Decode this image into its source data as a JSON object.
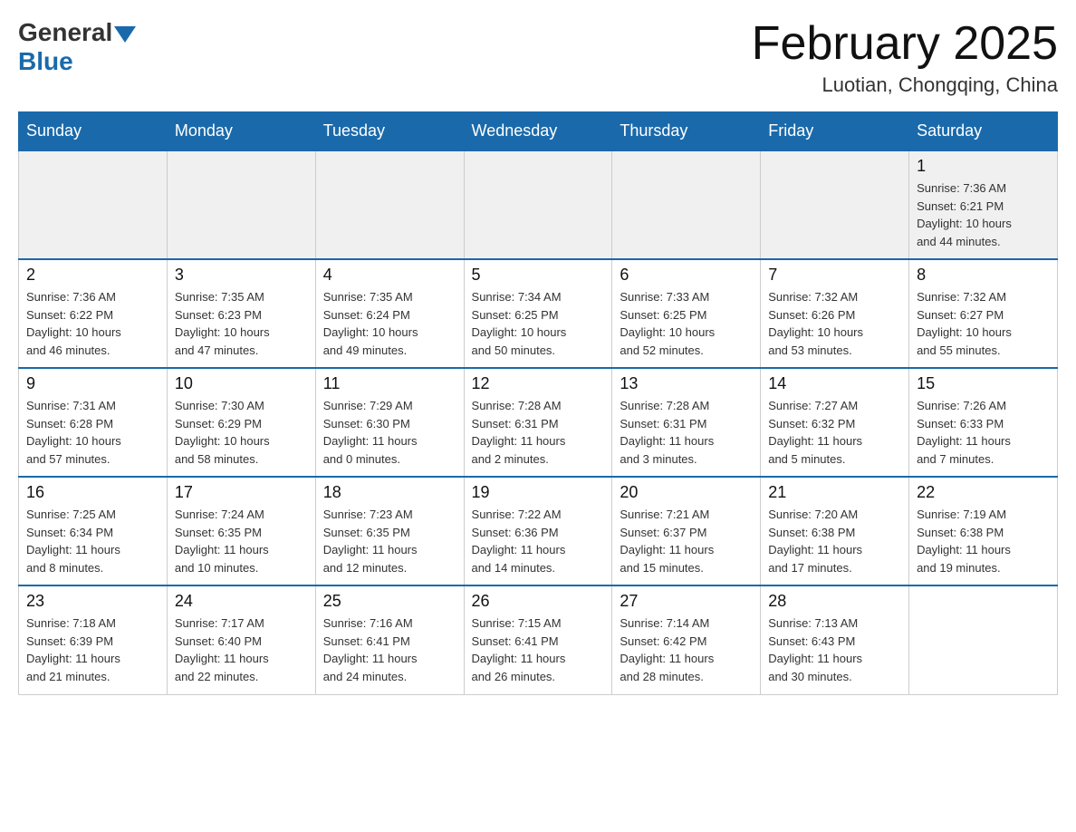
{
  "header": {
    "logo_general": "General",
    "logo_blue": "Blue",
    "title": "February 2025",
    "location": "Luotian, Chongqing, China"
  },
  "weekdays": [
    "Sunday",
    "Monday",
    "Tuesday",
    "Wednesday",
    "Thursday",
    "Friday",
    "Saturday"
  ],
  "weeks": [
    [
      {
        "day": "",
        "info": ""
      },
      {
        "day": "",
        "info": ""
      },
      {
        "day": "",
        "info": ""
      },
      {
        "day": "",
        "info": ""
      },
      {
        "day": "",
        "info": ""
      },
      {
        "day": "",
        "info": ""
      },
      {
        "day": "1",
        "info": "Sunrise: 7:36 AM\nSunset: 6:21 PM\nDaylight: 10 hours\nand 44 minutes."
      }
    ],
    [
      {
        "day": "2",
        "info": "Sunrise: 7:36 AM\nSunset: 6:22 PM\nDaylight: 10 hours\nand 46 minutes."
      },
      {
        "day": "3",
        "info": "Sunrise: 7:35 AM\nSunset: 6:23 PM\nDaylight: 10 hours\nand 47 minutes."
      },
      {
        "day": "4",
        "info": "Sunrise: 7:35 AM\nSunset: 6:24 PM\nDaylight: 10 hours\nand 49 minutes."
      },
      {
        "day": "5",
        "info": "Sunrise: 7:34 AM\nSunset: 6:25 PM\nDaylight: 10 hours\nand 50 minutes."
      },
      {
        "day": "6",
        "info": "Sunrise: 7:33 AM\nSunset: 6:25 PM\nDaylight: 10 hours\nand 52 minutes."
      },
      {
        "day": "7",
        "info": "Sunrise: 7:32 AM\nSunset: 6:26 PM\nDaylight: 10 hours\nand 53 minutes."
      },
      {
        "day": "8",
        "info": "Sunrise: 7:32 AM\nSunset: 6:27 PM\nDaylight: 10 hours\nand 55 minutes."
      }
    ],
    [
      {
        "day": "9",
        "info": "Sunrise: 7:31 AM\nSunset: 6:28 PM\nDaylight: 10 hours\nand 57 minutes."
      },
      {
        "day": "10",
        "info": "Sunrise: 7:30 AM\nSunset: 6:29 PM\nDaylight: 10 hours\nand 58 minutes."
      },
      {
        "day": "11",
        "info": "Sunrise: 7:29 AM\nSunset: 6:30 PM\nDaylight: 11 hours\nand 0 minutes."
      },
      {
        "day": "12",
        "info": "Sunrise: 7:28 AM\nSunset: 6:31 PM\nDaylight: 11 hours\nand 2 minutes."
      },
      {
        "day": "13",
        "info": "Sunrise: 7:28 AM\nSunset: 6:31 PM\nDaylight: 11 hours\nand 3 minutes."
      },
      {
        "day": "14",
        "info": "Sunrise: 7:27 AM\nSunset: 6:32 PM\nDaylight: 11 hours\nand 5 minutes."
      },
      {
        "day": "15",
        "info": "Sunrise: 7:26 AM\nSunset: 6:33 PM\nDaylight: 11 hours\nand 7 minutes."
      }
    ],
    [
      {
        "day": "16",
        "info": "Sunrise: 7:25 AM\nSunset: 6:34 PM\nDaylight: 11 hours\nand 8 minutes."
      },
      {
        "day": "17",
        "info": "Sunrise: 7:24 AM\nSunset: 6:35 PM\nDaylight: 11 hours\nand 10 minutes."
      },
      {
        "day": "18",
        "info": "Sunrise: 7:23 AM\nSunset: 6:35 PM\nDaylight: 11 hours\nand 12 minutes."
      },
      {
        "day": "19",
        "info": "Sunrise: 7:22 AM\nSunset: 6:36 PM\nDaylight: 11 hours\nand 14 minutes."
      },
      {
        "day": "20",
        "info": "Sunrise: 7:21 AM\nSunset: 6:37 PM\nDaylight: 11 hours\nand 15 minutes."
      },
      {
        "day": "21",
        "info": "Sunrise: 7:20 AM\nSunset: 6:38 PM\nDaylight: 11 hours\nand 17 minutes."
      },
      {
        "day": "22",
        "info": "Sunrise: 7:19 AM\nSunset: 6:38 PM\nDaylight: 11 hours\nand 19 minutes."
      }
    ],
    [
      {
        "day": "23",
        "info": "Sunrise: 7:18 AM\nSunset: 6:39 PM\nDaylight: 11 hours\nand 21 minutes."
      },
      {
        "day": "24",
        "info": "Sunrise: 7:17 AM\nSunset: 6:40 PM\nDaylight: 11 hours\nand 22 minutes."
      },
      {
        "day": "25",
        "info": "Sunrise: 7:16 AM\nSunset: 6:41 PM\nDaylight: 11 hours\nand 24 minutes."
      },
      {
        "day": "26",
        "info": "Sunrise: 7:15 AM\nSunset: 6:41 PM\nDaylight: 11 hours\nand 26 minutes."
      },
      {
        "day": "27",
        "info": "Sunrise: 7:14 AM\nSunset: 6:42 PM\nDaylight: 11 hours\nand 28 minutes."
      },
      {
        "day": "28",
        "info": "Sunrise: 7:13 AM\nSunset: 6:43 PM\nDaylight: 11 hours\nand 30 minutes."
      },
      {
        "day": "",
        "info": ""
      }
    ]
  ]
}
